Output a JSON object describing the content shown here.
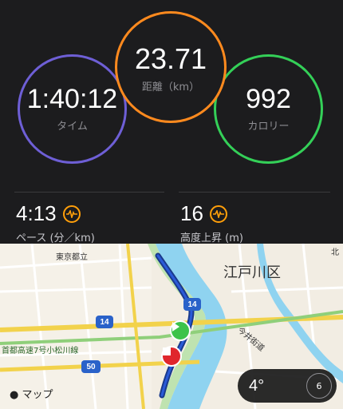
{
  "workout": {
    "time": {
      "value": "1:40:12",
      "label": "タイム"
    },
    "distance": {
      "value": "23.71",
      "label": "距離（km）"
    },
    "calories": {
      "value": "992",
      "label": "カロリー"
    },
    "pace": {
      "value": "4:13",
      "label": "ペース (分／km)"
    },
    "elevation": {
      "value": "16",
      "label": "高度上昇 (m)"
    }
  },
  "map": {
    "ward_label": "江戸川区",
    "attribution": "マップ",
    "roads": {
      "route14_a": "14",
      "route14_b": "14",
      "route50": "50",
      "expressway": "首都高速7号小松川線",
      "imai": "今井街道",
      "higashi": "東京都立",
      "east_road": "北"
    },
    "weather": {
      "temp": "4°",
      "aqi": "6"
    }
  }
}
